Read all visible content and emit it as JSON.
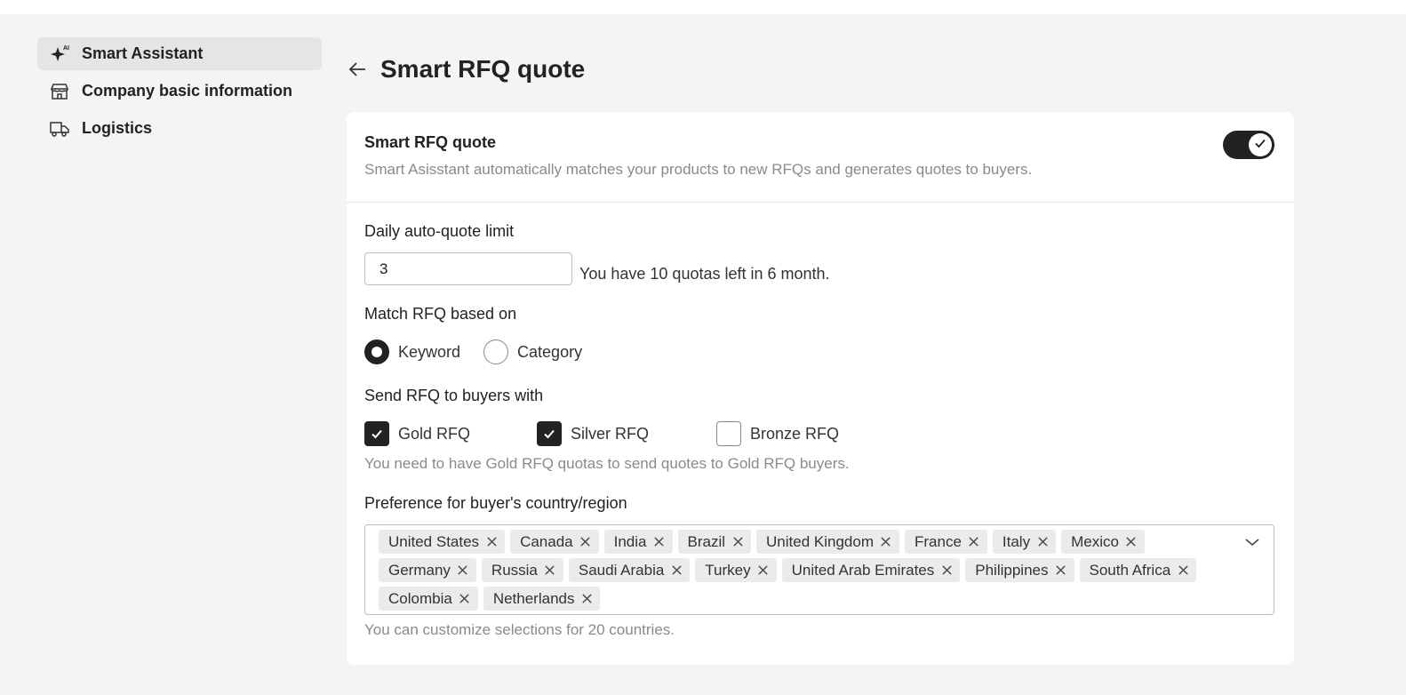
{
  "sidebar": {
    "items": [
      {
        "label": "Smart Assistant",
        "icon": "ai-sparkle-icon",
        "active": true
      },
      {
        "label": "Company basic information",
        "icon": "store-icon",
        "active": false
      },
      {
        "label": "Logistics",
        "icon": "truck-icon",
        "active": false
      }
    ]
  },
  "header": {
    "title": "Smart RFQ quote"
  },
  "smart_rfq": {
    "title": "Smart RFQ quote",
    "description": "Smart Asisstant automatically matches your products to new RFQs and generates quotes to buyers.",
    "enabled": true
  },
  "daily_limit": {
    "label": "Daily auto-quote limit",
    "value": "3",
    "quota_text": "You have 10 quotas left in 6 month."
  },
  "match": {
    "label": "Match RFQ based on",
    "options": [
      {
        "label": "Keyword",
        "selected": true
      },
      {
        "label": "Category",
        "selected": false
      }
    ]
  },
  "send_to": {
    "label": "Send RFQ to buyers with",
    "options": [
      {
        "label": "Gold RFQ",
        "checked": true
      },
      {
        "label": "Silver RFQ",
        "checked": true
      },
      {
        "label": "Bronze RFQ",
        "checked": false
      }
    ],
    "hint": "You need to have Gold RFQ quotas to send quotes to Gold RFQ buyers."
  },
  "countries": {
    "label": "Preference for buyer's country/region",
    "selected": [
      "United States",
      "Canada",
      "India",
      "Brazil",
      "United Kingdom",
      "France",
      "Italy",
      "Mexico",
      "Germany",
      "Russia",
      "Saudi Arabia",
      "Turkey",
      "United Arab Emirates",
      "Philippines",
      "South Africa",
      "Colombia",
      "Netherlands"
    ],
    "hint": "You can customize selections for 20 countries."
  },
  "colors": {
    "accent": "#222222",
    "muted_text": "#8a8a8a",
    "page_bg": "#f4f4f4",
    "tag_bg": "#ebebeb"
  }
}
